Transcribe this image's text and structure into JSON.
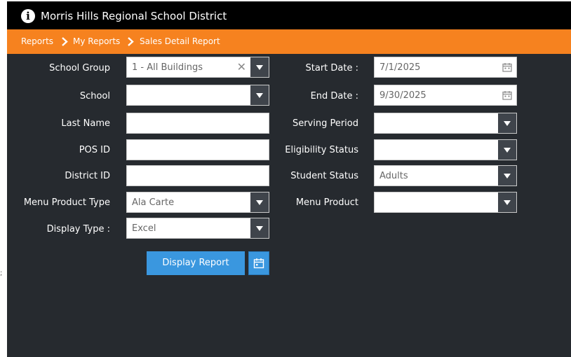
{
  "app": {
    "title": "Morris Hills Regional School District",
    "accent": "#f6821f",
    "background": "#262a2f",
    "button_color": "#3a97df"
  },
  "breadcrumb": [
    {
      "label": "Reports"
    },
    {
      "label": "My Reports"
    },
    {
      "label": "Sales Detail Report"
    }
  ],
  "form": {
    "school_group": {
      "label": "School Group",
      "value": "1 - All Buildings"
    },
    "school": {
      "label": "School",
      "value": ""
    },
    "last_name": {
      "label": "Last Name",
      "value": ""
    },
    "pos_id": {
      "label": "POS ID",
      "value": ""
    },
    "district_id": {
      "label": "District ID",
      "value": ""
    },
    "menu_product_type": {
      "label": "Menu Product Type",
      "value": "Ala Carte"
    },
    "display_type": {
      "label": "Display Type :",
      "value": "Excel"
    },
    "start_date": {
      "label": "Start Date :",
      "value": "7/1/2025"
    },
    "end_date": {
      "label": "End Date :",
      "value": "9/30/2025"
    },
    "serving_period": {
      "label": "Serving Period",
      "value": ""
    },
    "eligibility_status": {
      "label": "Eligibility Status",
      "value": ""
    },
    "student_status": {
      "label": "Student Status",
      "value": "Adults"
    },
    "menu_product": {
      "label": "Menu Product",
      "value": ""
    }
  },
  "actions": {
    "display_report": "Display Report"
  },
  "icons": {
    "header": "info-icon",
    "clear": "close-icon",
    "calendar": "calendar-icon",
    "dropdown": "triangle-down-icon",
    "separator": "chevron-right-icon"
  },
  "misc": {
    "stray_mark": ";"
  }
}
